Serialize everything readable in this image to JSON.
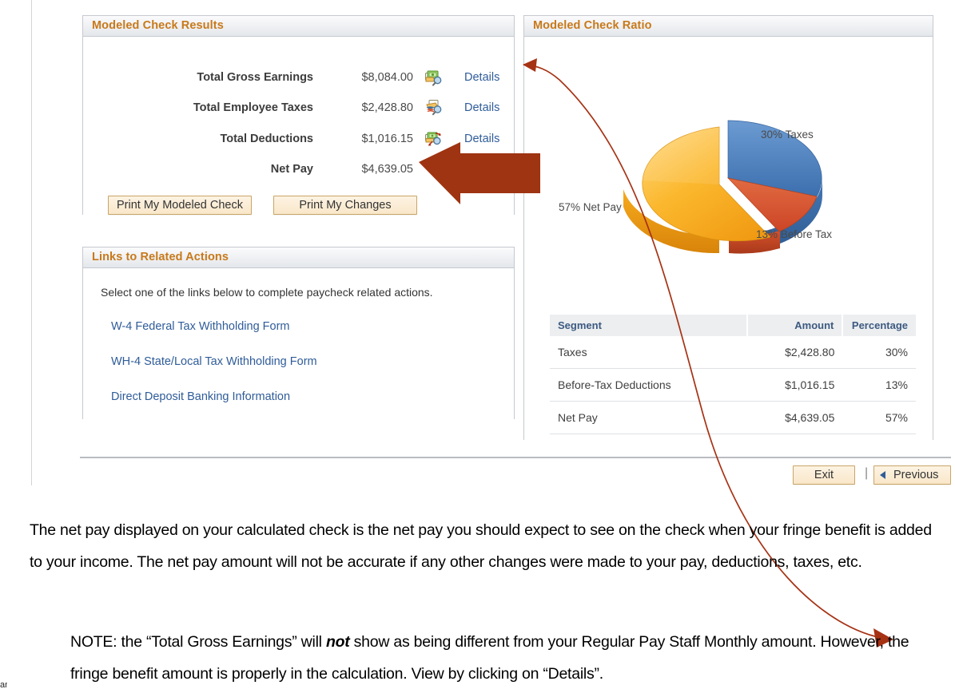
{
  "results": {
    "title": "Modeled Check Results",
    "rows": [
      {
        "label": "Total Gross Earnings",
        "value": "$8,084.00",
        "details": "Details",
        "icon": "earnings-magnifier-icon",
        "has_details": true
      },
      {
        "label": "Total Employee Taxes",
        "value": "$2,428.80",
        "details": "Details",
        "icon": "taxes-magnifier-icon",
        "has_details": true
      },
      {
        "label": "Total Deductions",
        "value": "$1,016.15",
        "details": "Details",
        "icon": "deductions-magnifier-icon",
        "has_details": true
      },
      {
        "label": "Net Pay",
        "value": "$4,639.05",
        "details": "",
        "icon": "",
        "has_details": false
      }
    ],
    "print_check_label": "Print My Modeled Check",
    "print_changes_label": "Print My Changes"
  },
  "links_panel": {
    "title": "Links to Related Actions",
    "intro": "Select one of the links below to complete paycheck related actions.",
    "links": [
      "W-4 Federal Tax Withholding Form",
      "WH-4 State/Local Tax Withholding Form",
      "Direct Deposit Banking Information"
    ]
  },
  "ratio_panel": {
    "title": "Modeled Check Ratio",
    "table": {
      "headers": [
        "Segment",
        "Amount",
        "Percentage"
      ],
      "rows": [
        {
          "segment": "Taxes",
          "amount": "$2,428.80",
          "percentage": "30%"
        },
        {
          "segment": "Before-Tax Deductions",
          "amount": "$1,016.15",
          "percentage": "13%"
        },
        {
          "segment": "Net Pay",
          "amount": "$4,639.05",
          "percentage": "57%"
        }
      ]
    }
  },
  "chart_data": {
    "type": "pie",
    "title": "Modeled Check Ratio",
    "labels": [
      "Taxes",
      "Before Tax",
      "Net Pay"
    ],
    "values": [
      30,
      13,
      57
    ],
    "amounts": [
      "$2,428.80",
      "$1,016.15",
      "$4,639.05"
    ],
    "colors": [
      "#4a7ebb",
      "#d4502b",
      "#f5a623"
    ],
    "data_labels": [
      "30% Taxes",
      "13% Before Tax",
      "57% Net Pay"
    ],
    "legend": "none",
    "three_d": true,
    "exploded_slice": "Net Pay",
    "units": "percent"
  },
  "footer": {
    "exit_label": "Exit",
    "separator": "|",
    "previous_label": "Previous",
    "previous_icon": "left-triangle-icon"
  },
  "annotations": {
    "paragraph_1": "The net pay displayed on your calculated check is the net pay you should expect to see on the check when your fringe benefit is added to your income.  The net pay amount will not be accurate if any other changes were made to your pay, deductions, taxes, etc.",
    "note_part_1": "NOTE:  the “Total Gross Earnings” will ",
    "note_emphasis": "not",
    "note_part_2": " show as being different from your Regular Pay Staff Monthly amount. However, the fringe benefit amount is properly in the calculation. View by clicking on “Details”.",
    "arrow_color": "#a63214",
    "block_arrow_color": "#9e3412",
    "bottom_mark": "ami"
  }
}
